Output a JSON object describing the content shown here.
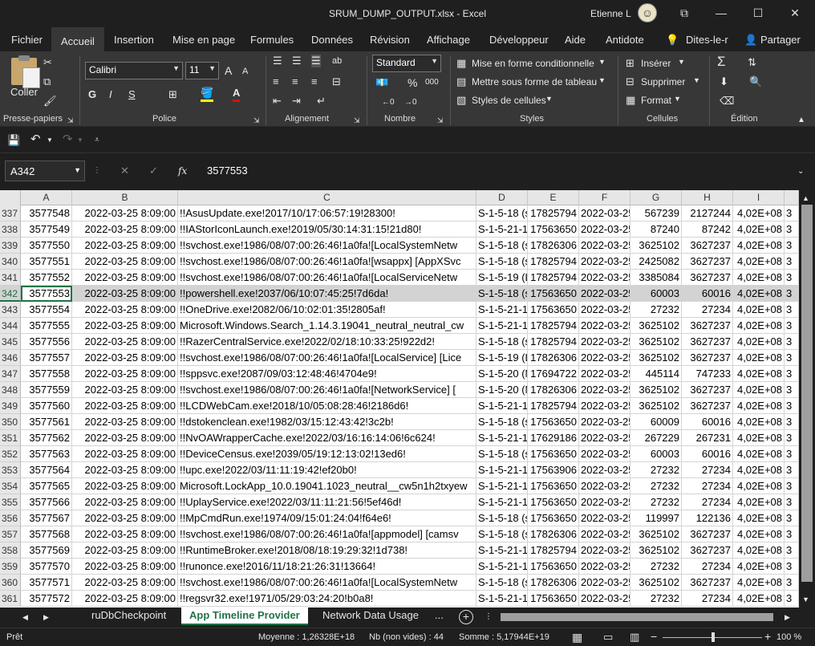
{
  "window": {
    "title": "SRUM_DUMP_OUTPUT.xlsx  -  Excel",
    "user": "Etienne L",
    "controls": {
      "ribbon_display": "⧉",
      "minimize": "—",
      "maximize": "☐",
      "close": "✕"
    }
  },
  "menu_tabs": [
    "Fichier",
    "Accueil",
    "Insertion",
    "Mise en page",
    "Formules",
    "Données",
    "Révision",
    "Affichage",
    "Développeur",
    "Aide",
    "Antidote",
    "Dites-le-r",
    "Partager"
  ],
  "active_tab": "Accueil",
  "ribbon": {
    "clipboard": {
      "paste_label": "Coller",
      "group_label": "Presse-papiers"
    },
    "font": {
      "family": "Calibri",
      "size": "11",
      "bold": "G",
      "italic": "I",
      "underline": "S",
      "grow": "A",
      "shrink": "A",
      "group_label": "Police"
    },
    "alignment": {
      "group_label": "Alignement"
    },
    "number": {
      "format": "Standard",
      "percent": "%",
      "thousands": "000",
      "group_label": "Nombre"
    },
    "styles": {
      "conditional": "Mise en forme conditionnelle",
      "table": "Mettre sous forme de tableau",
      "cell_styles": "Styles de cellules",
      "group_label": "Styles"
    },
    "cells": {
      "insert": "Insérer",
      "delete": "Supprimer",
      "format": "Format",
      "group_label": "Cellules"
    },
    "editing": {
      "group_label": "Édition"
    }
  },
  "formula_bar": {
    "name_box": "A342",
    "fx": "fx",
    "value": "3577553"
  },
  "grid": {
    "columns": [
      "A",
      "B",
      "C",
      "D",
      "E",
      "F",
      "G",
      "H",
      "I",
      ""
    ],
    "selected_row": "342",
    "rows": [
      {
        "n": "337",
        "a": "3577548",
        "b": "2022-03-25 8:09:00",
        "c": "!!AsusUpdate.exe!2017/10/17:06:57:19!28300!",
        "d": "S-1-5-18 (s",
        "e": "17825794",
        "f": "2022-03-25",
        "g": "567239",
        "h": "2127244",
        "i": "4,02E+08",
        "j": "3"
      },
      {
        "n": "338",
        "a": "3577549",
        "b": "2022-03-25 8:09:00",
        "c": "!!IAStorIconLaunch.exe!2019/05/30:14:31:15!21d80!",
        "d": "S-1-5-21-1",
        "e": "17563650",
        "f": "2022-03-25",
        "g": "87240",
        "h": "87242",
        "i": "4,02E+08",
        "j": "3"
      },
      {
        "n": "339",
        "a": "3577550",
        "b": "2022-03-25 8:09:00",
        "c": "!!svchost.exe!1986/08/07:00:26:46!1a0fa![LocalSystemNetw",
        "d": "S-1-5-18 (s",
        "e": "17826306",
        "f": "2022-03-25",
        "g": "3625102",
        "h": "3627237",
        "i": "4,02E+08",
        "j": "3"
      },
      {
        "n": "340",
        "a": "3577551",
        "b": "2022-03-25 8:09:00",
        "c": "!!svchost.exe!1986/08/07:00:26:46!1a0fa![wsappx] [AppXSvc",
        "d": "S-1-5-18 (s",
        "e": "17825794",
        "f": "2022-03-25",
        "g": "2425082",
        "h": "3627237",
        "i": "4,02E+08",
        "j": "3"
      },
      {
        "n": "341",
        "a": "3577552",
        "b": "2022-03-25 8:09:00",
        "c": "!!svchost.exe!1986/08/07:00:26:46!1a0fa![LocalServiceNetw",
        "d": "S-1-5-19 (L",
        "e": "17825794",
        "f": "2022-03-25",
        "g": "3385084",
        "h": "3627237",
        "i": "4,02E+08",
        "j": "3"
      },
      {
        "n": "342",
        "a": "3577553",
        "b": "2022-03-25 8:09:00",
        "c": "!!powershell.exe!2037/06/10:07:45:25!7d6da!",
        "d": "S-1-5-18 (s",
        "e": "17563650",
        "f": "2022-03-25",
        "g": "60003",
        "h": "60016",
        "i": "4,02E+08",
        "j": "3"
      },
      {
        "n": "343",
        "a": "3577554",
        "b": "2022-03-25 8:09:00",
        "c": "!!OneDrive.exe!2082/06/10:02:01:35!2805af!",
        "d": "S-1-5-21-1",
        "e": "17563650",
        "f": "2022-03-25",
        "g": "27232",
        "h": "27234",
        "i": "4,02E+08",
        "j": "3"
      },
      {
        "n": "344",
        "a": "3577555",
        "b": "2022-03-25 8:09:00",
        "c": "Microsoft.Windows.Search_1.14.3.19041_neutral_neutral_cw",
        "d": "S-1-5-21-1",
        "e": "17825794",
        "f": "2022-03-25",
        "g": "3625102",
        "h": "3627237",
        "i": "4,02E+08",
        "j": "3"
      },
      {
        "n": "345",
        "a": "3577556",
        "b": "2022-03-25 8:09:00",
        "c": "!!RazerCentralService.exe!2022/02/18:10:33:25!922d2!",
        "d": "S-1-5-18 (s",
        "e": "17825794",
        "f": "2022-03-25",
        "g": "3625102",
        "h": "3627237",
        "i": "4,02E+08",
        "j": "3"
      },
      {
        "n": "346",
        "a": "3577557",
        "b": "2022-03-25 8:09:00",
        "c": "!!svchost.exe!1986/08/07:00:26:46!1a0fa![LocalService] [Lice",
        "d": "S-1-5-19 (L",
        "e": "17826306",
        "f": "2022-03-25",
        "g": "3625102",
        "h": "3627237",
        "i": "4,02E+08",
        "j": "3"
      },
      {
        "n": "347",
        "a": "3577558",
        "b": "2022-03-25 8:09:00",
        "c": "!!sppsvc.exe!2087/09/03:12:48:46!4704e9!",
        "d": "S-1-5-20 (N",
        "e": "17694722",
        "f": "2022-03-25",
        "g": "445114",
        "h": "747233",
        "i": "4,02E+08",
        "j": "3"
      },
      {
        "n": "348",
        "a": "3577559",
        "b": "2022-03-25 8:09:00",
        "c": "!!svchost.exe!1986/08/07:00:26:46!1a0fa![NetworkService] [",
        "d": "S-1-5-20 (N",
        "e": "17826306",
        "f": "2022-03-25",
        "g": "3625102",
        "h": "3627237",
        "i": "4,02E+08",
        "j": "3"
      },
      {
        "n": "349",
        "a": "3577560",
        "b": "2022-03-25 8:09:00",
        "c": "!!LCDWebCam.exe!2018/10/05:08:28:46!2186d6!",
        "d": "S-1-5-21-1",
        "e": "17825794",
        "f": "2022-03-25",
        "g": "3625102",
        "h": "3627237",
        "i": "4,02E+08",
        "j": "3"
      },
      {
        "n": "350",
        "a": "3577561",
        "b": "2022-03-25 8:09:00",
        "c": "!!dstokenclean.exe!1982/03/15:12:43:42!3c2b!",
        "d": "S-1-5-18 (s",
        "e": "17563650",
        "f": "2022-03-25",
        "g": "60009",
        "h": "60016",
        "i": "4,02E+08",
        "j": "3"
      },
      {
        "n": "351",
        "a": "3577562",
        "b": "2022-03-25 8:09:00",
        "c": "!!NvOAWrapperCache.exe!2022/03/16:16:14:06!6c624!",
        "d": "S-1-5-21-1",
        "e": "17629186",
        "f": "2022-03-25",
        "g": "267229",
        "h": "267231",
        "i": "4,02E+08",
        "j": "3"
      },
      {
        "n": "352",
        "a": "3577563",
        "b": "2022-03-25 8:09:00",
        "c": "!!DeviceCensus.exe!2039/05/19:12:13:02!13ed6!",
        "d": "S-1-5-18 (s",
        "e": "17563650",
        "f": "2022-03-25",
        "g": "60003",
        "h": "60016",
        "i": "4,02E+08",
        "j": "3"
      },
      {
        "n": "353",
        "a": "3577564",
        "b": "2022-03-25 8:09:00",
        "c": "!!upc.exe!2022/03/11:11:19:42!ef20b0!",
        "d": "S-1-5-21-1",
        "e": "17563906",
        "f": "2022-03-25",
        "g": "27232",
        "h": "27234",
        "i": "4,02E+08",
        "j": "3"
      },
      {
        "n": "354",
        "a": "3577565",
        "b": "2022-03-25 8:09:00",
        "c": "Microsoft.LockApp_10.0.19041.1023_neutral__cw5n1h2txyew",
        "d": "S-1-5-21-1",
        "e": "17563650",
        "f": "2022-03-25",
        "g": "27232",
        "h": "27234",
        "i": "4,02E+08",
        "j": "3"
      },
      {
        "n": "355",
        "a": "3577566",
        "b": "2022-03-25 8:09:00",
        "c": "!!UplayService.exe!2022/03/11:11:21:56!5ef46d!",
        "d": "S-1-5-21-1",
        "e": "17563650",
        "f": "2022-03-25",
        "g": "27232",
        "h": "27234",
        "i": "4,02E+08",
        "j": "3"
      },
      {
        "n": "356",
        "a": "3577567",
        "b": "2022-03-25 8:09:00",
        "c": "!!MpCmdRun.exe!1974/09/15:01:24:04!f64e6!",
        "d": "S-1-5-18 (s",
        "e": "17563650",
        "f": "2022-03-25",
        "g": "119997",
        "h": "122136",
        "i": "4,02E+08",
        "j": "3"
      },
      {
        "n": "357",
        "a": "3577568",
        "b": "2022-03-25 8:09:00",
        "c": "!!svchost.exe!1986/08/07:00:26:46!1a0fa![appmodel] [camsv",
        "d": "S-1-5-18 (s",
        "e": "17826306",
        "f": "2022-03-25",
        "g": "3625102",
        "h": "3627237",
        "i": "4,02E+08",
        "j": "3"
      },
      {
        "n": "358",
        "a": "3577569",
        "b": "2022-03-25 8:09:00",
        "c": "!!RuntimeBroker.exe!2018/08/18:19:29:32!1d738!",
        "d": "S-1-5-21-1",
        "e": "17825794",
        "f": "2022-03-25",
        "g": "3625102",
        "h": "3627237",
        "i": "4,02E+08",
        "j": "3"
      },
      {
        "n": "359",
        "a": "3577570",
        "b": "2022-03-25 8:09:00",
        "c": "!!runonce.exe!2016/11/18:21:26:31!13664!",
        "d": "S-1-5-21-1",
        "e": "17563650",
        "f": "2022-03-25",
        "g": "27232",
        "h": "27234",
        "i": "4,02E+08",
        "j": "3"
      },
      {
        "n": "360",
        "a": "3577571",
        "b": "2022-03-25 8:09:00",
        "c": "!!svchost.exe!1986/08/07:00:26:46!1a0fa![LocalSystemNetw",
        "d": "S-1-5-18 (s",
        "e": "17826306",
        "f": "2022-03-25",
        "g": "3625102",
        "h": "3627237",
        "i": "4,02E+08",
        "j": "3"
      },
      {
        "n": "361",
        "a": "3577572",
        "b": "2022-03-25 8:09:00",
        "c": "!!regsvr32.exe!1971/05/29:03:24:20!b0a8!",
        "d": "S-1-5-21-1",
        "e": "17563650",
        "f": "2022-03-25",
        "g": "27232",
        "h": "27234",
        "i": "4,02E+08",
        "j": "3"
      }
    ]
  },
  "sheets": {
    "tabs": [
      "ruDbCheckpoint",
      "App Timeline Provider",
      "Network Data Usage"
    ],
    "active": "App Timeline Provider",
    "more": "..."
  },
  "status": {
    "ready": "Prêt",
    "average": "Moyenne : 1,26328E+18",
    "count": "Nb (non vides) : 44",
    "sum": "Somme : 5,17944E+19",
    "zoom": "100 %",
    "zoom_minus": "−",
    "zoom_plus": "+"
  },
  "colors": {
    "accent": "#217346",
    "chrome": "#1f1f1f",
    "ribbon": "#373737"
  }
}
